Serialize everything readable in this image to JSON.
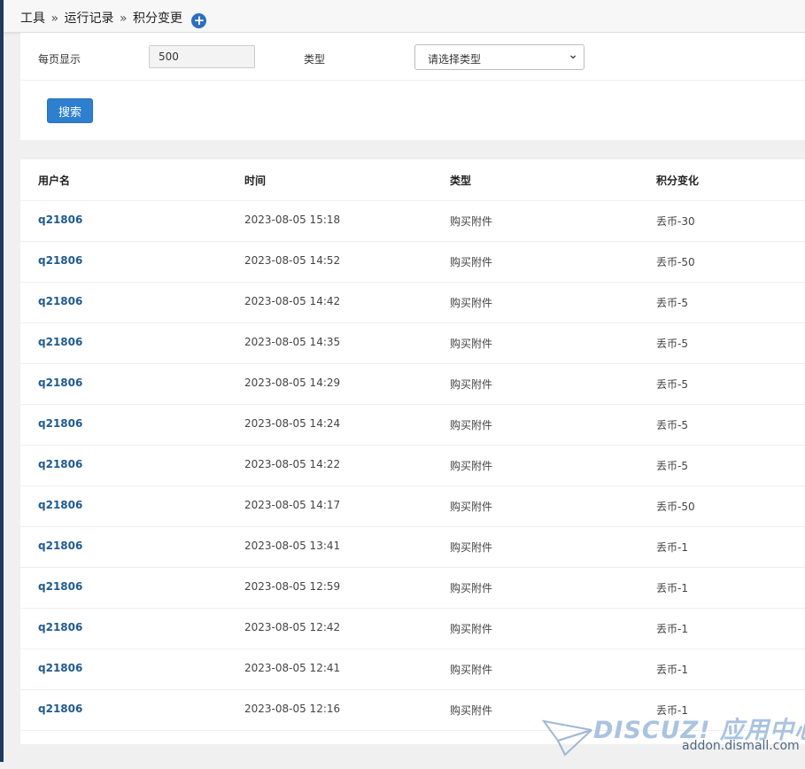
{
  "breadcrumb": {
    "items": [
      "工具",
      "运行记录",
      "积分变更"
    ],
    "separator": "»",
    "add_icon": "plus-circle-icon"
  },
  "filter": {
    "per_page_label": "每页显示",
    "per_page_value": "500",
    "type_label": "类型",
    "type_select_value": "请选择类型",
    "search_button": "搜索"
  },
  "table": {
    "headers": [
      "用户名",
      "时间",
      "类型",
      "积分变化"
    ],
    "rows": [
      {
        "user": "q21806",
        "time": "2023-08-05 15:18",
        "type": "购买附件",
        "change": "丢币-30"
      },
      {
        "user": "q21806",
        "time": "2023-08-05 14:52",
        "type": "购买附件",
        "change": "丢币-50"
      },
      {
        "user": "q21806",
        "time": "2023-08-05 14:42",
        "type": "购买附件",
        "change": "丢币-5"
      },
      {
        "user": "q21806",
        "time": "2023-08-05 14:35",
        "type": "购买附件",
        "change": "丢币-5"
      },
      {
        "user": "q21806",
        "time": "2023-08-05 14:29",
        "type": "购买附件",
        "change": "丢币-5"
      },
      {
        "user": "q21806",
        "time": "2023-08-05 14:24",
        "type": "购买附件",
        "change": "丢币-5"
      },
      {
        "user": "q21806",
        "time": "2023-08-05 14:22",
        "type": "购买附件",
        "change": "丢币-5"
      },
      {
        "user": "q21806",
        "time": "2023-08-05 14:17",
        "type": "购买附件",
        "change": "丢币-50"
      },
      {
        "user": "q21806",
        "time": "2023-08-05 13:41",
        "type": "购买附件",
        "change": "丢币-1"
      },
      {
        "user": "q21806",
        "time": "2023-08-05 12:59",
        "type": "购买附件",
        "change": "丢币-1"
      },
      {
        "user": "q21806",
        "time": "2023-08-05 12:42",
        "type": "购买附件",
        "change": "丢币-1"
      },
      {
        "user": "q21806",
        "time": "2023-08-05 12:41",
        "type": "购买附件",
        "change": "丢币-1"
      },
      {
        "user": "q21806",
        "time": "2023-08-05 12:16",
        "type": "购买附件",
        "change": "丢币-1"
      }
    ]
  },
  "watermark": {
    "brand": "DISCUZ! 应用中心",
    "url": "addon.dismall.com"
  },
  "colors": {
    "accent": "#2f7fd0",
    "link": "#1f5a8f",
    "sidebar_strip": "#1d3b5e",
    "page_bg": "#f0f0f0"
  }
}
